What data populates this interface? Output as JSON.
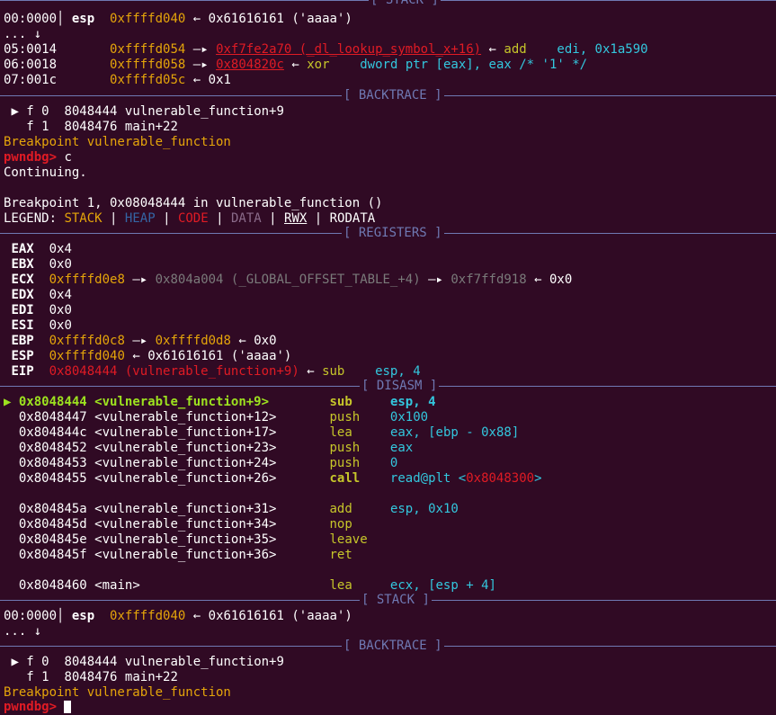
{
  "stack_top": {
    "title": "STACK",
    "l0": {
      "off": "00:0000",
      "reg": "esp",
      "addr": "0xffffd040",
      "arrow": "←",
      "val": "0x61616161 ('aaaa')"
    },
    "l1": {
      "text": "... ↓"
    },
    "l2": {
      "off": "05:0014",
      "addr": "0xffffd054",
      "a1": "—▸",
      "sym": "0xf7fe2a70 (_dl_lookup_symbol_x+16)",
      "a2": "←",
      "ins": "add",
      "op": "edi, 0x1a590"
    },
    "l3": {
      "off": "06:0018",
      "addr": "0xffffd058",
      "a1": "—▸",
      "sym": "0x804820c",
      "a2": "←",
      "ins": "xor",
      "op": "dword ptr [eax], eax /* '1' */"
    },
    "l4": {
      "off": "07:001c",
      "addr": "0xffffd05c",
      "a1": "←",
      "val": "0x1"
    }
  },
  "backtrace_1": {
    "title": "BACKTRACE",
    "f0": {
      "mark": "▶ f 0",
      "addr": "8048444",
      "fn": "vulnerable_function+9"
    },
    "f1": {
      "mark": "  f 1",
      "addr": "8048476",
      "fn": "main+22"
    },
    "bp": "Breakpoint vulnerable_function"
  },
  "session": {
    "prompt": "pwndbg>",
    "cmd": "c",
    "continuing": "Continuing.",
    "breakpoint_hit": "Breakpoint 1, 0x08048444 in vulnerable_function ()",
    "legend": {
      "label": "LEGEND:",
      "stack": "STACK",
      "heap": "HEAP",
      "code": "CODE",
      "data": "DATA",
      "rwx": "RWX",
      "rodata": "RODATA",
      "sep": "|"
    }
  },
  "registers": {
    "title": "REGISTERS",
    "eax": {
      "name": "EAX",
      "val": "0x4"
    },
    "ebx": {
      "name": "EBX",
      "val": "0x0"
    },
    "ecx": {
      "name": "ECX",
      "v1": "0xffffd0e8",
      "a1": "—▸",
      "v2": "0x804a004 (_GLOBAL_OFFSET_TABLE_+4)",
      "a2": "—▸",
      "v3": "0xf7ffd918",
      "a3": "←",
      "v4": "0x0"
    },
    "edx": {
      "name": "EDX",
      "val": "0x4"
    },
    "edi": {
      "name": "EDI",
      "val": "0x0"
    },
    "esi": {
      "name": "ESI",
      "val": "0x0"
    },
    "ebp": {
      "name": "EBP",
      "v1": "0xffffd0c8",
      "a1": "—▸",
      "v2": "0xffffd0d8",
      "a2": "←",
      "v3": "0x0"
    },
    "esp": {
      "name": "ESP",
      "v1": "0xffffd040",
      "a1": "←",
      "v2": "0x61616161 ('aaaa')"
    },
    "eip": {
      "name": "EIP",
      "v1": "0x8048444 (vulnerable_function+9)",
      "a1": "←",
      "ins": "sub",
      "op": "esp, 4"
    }
  },
  "disasm": {
    "title": "DISASM",
    "rows": [
      {
        "mark": "▶",
        "addr": "0x8048444",
        "sym": "<vulnerable_function+9>",
        "ins": "sub",
        "op": "esp, 4"
      },
      {
        "mark": " ",
        "addr": "0x8048447",
        "sym": "<vulnerable_function+12>",
        "ins": "push",
        "op": "0x100"
      },
      {
        "mark": " ",
        "addr": "0x804844c",
        "sym": "<vulnerable_function+17>",
        "ins": "lea",
        "op1": "eax, [ebp - ",
        "op2": "0x88",
        "op3": "]"
      },
      {
        "mark": " ",
        "addr": "0x8048452",
        "sym": "<vulnerable_function+23>",
        "ins": "push",
        "op": "eax"
      },
      {
        "mark": " ",
        "addr": "0x8048453",
        "sym": "<vulnerable_function+24>",
        "ins": "push",
        "op": "0"
      },
      {
        "mark": " ",
        "addr": "0x8048455",
        "sym": "<vulnerable_function+26>",
        "ins": "call",
        "op1": "read@plt <",
        "op2": "0x8048300",
        "op3": ">"
      },
      {
        "mark": " ",
        "addr": "0x804845a",
        "sym": "<vulnerable_function+31>",
        "ins": "add",
        "op": "esp, 0x10"
      },
      {
        "mark": " ",
        "addr": "0x804845d",
        "sym": "<vulnerable_function+34>",
        "ins": "nop",
        "op": ""
      },
      {
        "mark": " ",
        "addr": "0x804845e",
        "sym": "<vulnerable_function+35>",
        "ins": "leave",
        "op": ""
      },
      {
        "mark": " ",
        "addr": "0x804845f",
        "sym": "<vulnerable_function+36>",
        "ins": "ret",
        "op": ""
      },
      {
        "mark": " ",
        "addr": "0x8048460",
        "sym": "<main>",
        "ins": "lea",
        "op1": "ecx, [esp + ",
        "op2": "4",
        "op3": "]"
      }
    ]
  },
  "stack_bottom": {
    "title": "STACK",
    "l0": {
      "off": "00:0000",
      "reg": "esp",
      "addr": "0xffffd040",
      "arrow": "←",
      "val": "0x61616161 ('aaaa')"
    },
    "l1": {
      "text": "... ↓"
    }
  },
  "backtrace_2": {
    "title": "BACKTRACE",
    "f0": {
      "mark": "▶ f 0",
      "addr": "8048444",
      "fn": "vulnerable_function+9"
    },
    "f1": {
      "mark": "  f 1",
      "addr": "8048476",
      "fn": "main+22"
    },
    "bp": "Breakpoint vulnerable_function"
  },
  "colors": {
    "background": "#300a24",
    "separator": "#6f79b3",
    "stack": "#e5a50a",
    "code": "#e01b24",
    "mnemonic": "#c6c62a",
    "operand": "#33c7de",
    "current": "#9de21f"
  }
}
